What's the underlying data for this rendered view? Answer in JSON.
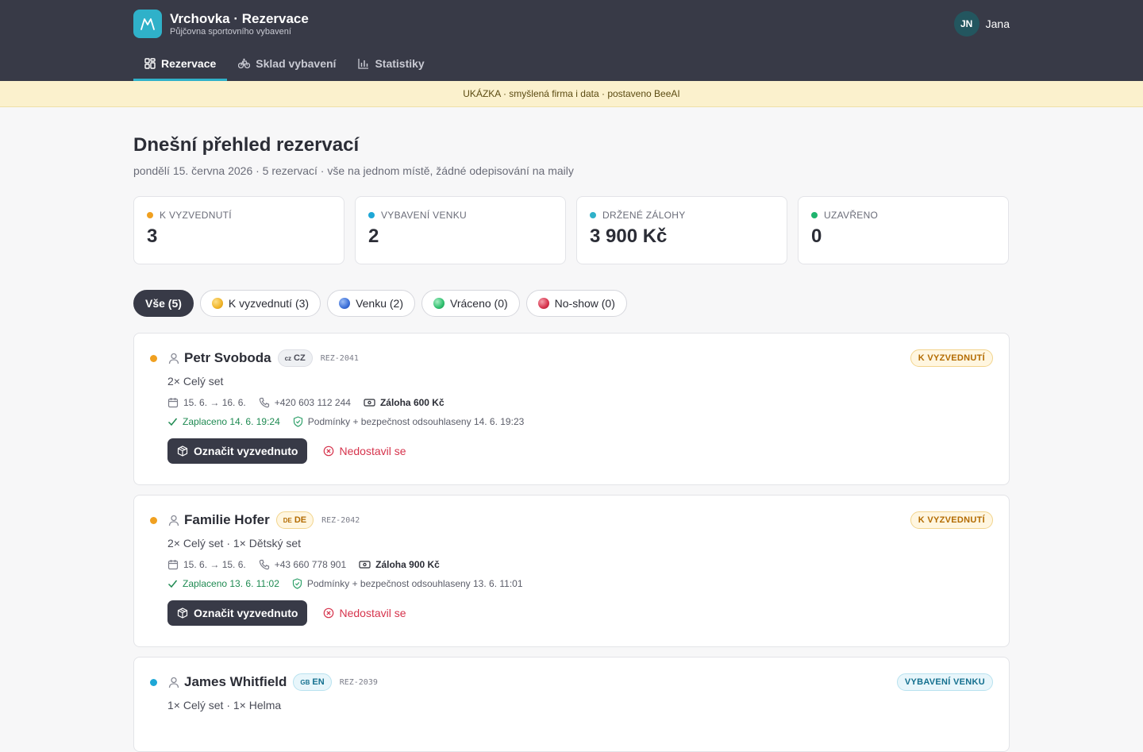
{
  "app": {
    "title": "Vrchovka · Rezervace",
    "subtitle": "Půjčovna sportovního vybavení",
    "user_initials": "JN",
    "user_name": "Jana"
  },
  "nav": {
    "tabs": [
      {
        "label": "Rezervace",
        "icon": "dashboard-icon",
        "active": true
      },
      {
        "label": "Sklad vybavení",
        "icon": "bike-icon",
        "active": false
      },
      {
        "label": "Statistiky",
        "icon": "chart-icon",
        "active": false
      }
    ]
  },
  "banner": "UKÁZKA · smyšlená firma i data · postaveno BeeAI",
  "page": {
    "title": "Dnešní přehled rezervací",
    "subtitle": "pondělí 15. června 2026 · 5 rezervací · vše na jednom místě, žádné odepisování na maily"
  },
  "stats": [
    {
      "label": "K VYZVEDNUTÍ",
      "value": "3",
      "color": "#f0a020"
    },
    {
      "label": "VYBAVENÍ VENKU",
      "value": "2",
      "color": "#1ea7d6"
    },
    {
      "label": "DRŽENÉ ZÁLOHY",
      "value": "3 900 Kč",
      "color": "#2fb1c9"
    },
    {
      "label": "UZAVŘENO",
      "value": "0",
      "color": "#1fb46e"
    }
  ],
  "filters": [
    {
      "label": "Vše (5)",
      "active": true
    },
    {
      "label": "K vyzvednutí (3)",
      "color": "#f0b429"
    },
    {
      "label": "Venku (2)",
      "color": "#3b6fd8"
    },
    {
      "label": "Vráceno (0)",
      "color": "#2fbf6e"
    },
    {
      "label": "No-show (0)",
      "color": "#d6334c"
    }
  ],
  "reservations": [
    {
      "name": "Petr Svoboda",
      "lang_flag": "cz",
      "lang": "CZ",
      "id": "REZ-2041",
      "status": "K VYZVEDNUTÍ",
      "items": "2× Celý set",
      "dates": "15. 6. → 16. 6.",
      "phone": "+420 603 112 244",
      "deposit": "Záloha 600 Kč",
      "paid": "Zaplaceno 14. 6. 19:24",
      "terms": "Podmínky + bezpečnost odsouhlaseny 14. 6. 19:23",
      "primary_action": "Označit vyzvednuto",
      "secondary_action": "Nedostavil se"
    },
    {
      "name": "Familie Hofer",
      "lang_flag": "DE",
      "lang": "DE",
      "id": "REZ-2042",
      "status": "K VYZVEDNUTÍ",
      "items": "2× Celý set · 1× Dětský set",
      "dates": "15. 6. → 15. 6.",
      "phone": "+43 660 778 901",
      "deposit": "Záloha 900 Kč",
      "paid": "Zaplaceno 13. 6. 11:02",
      "terms": "Podmínky + bezpečnost odsouhlaseny 13. 6. 11:01",
      "primary_action": "Označit vyzvednuto",
      "secondary_action": "Nedostavil se"
    },
    {
      "name": "James Whitfield",
      "lang_flag": "GB",
      "lang": "EN",
      "id": "REZ-2039",
      "status": "VYBAVENÍ VENKU",
      "items": "1× Celý set · 1× Helma"
    }
  ],
  "colors": {
    "header_bg": "#383a47",
    "accent": "#2fb1c9",
    "pending": "#f0a020",
    "out": "#1ea7d6",
    "danger": "#d6334c",
    "success": "#1f8a52"
  }
}
